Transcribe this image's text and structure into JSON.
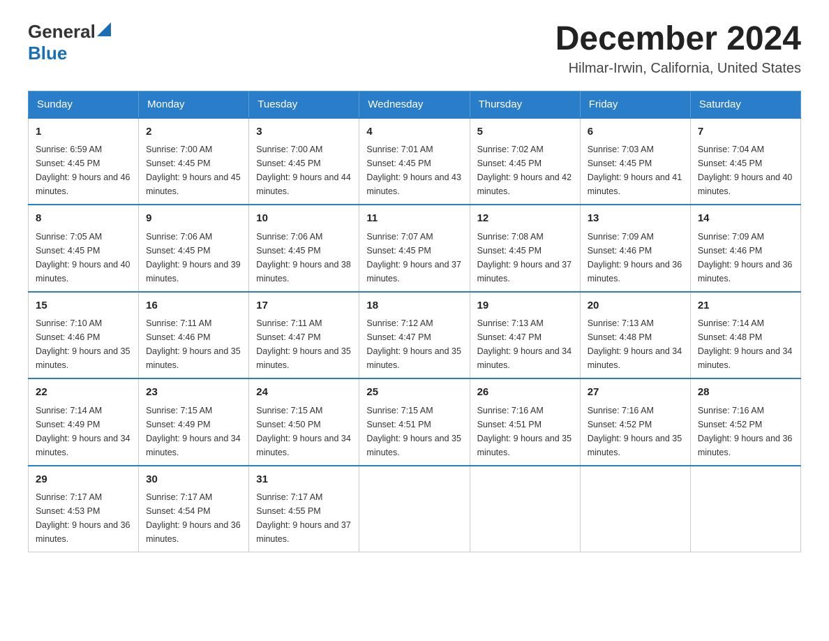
{
  "header": {
    "logo": {
      "text_general": "General",
      "text_blue": "Blue",
      "aria": "GeneralBlue logo"
    },
    "title": "December 2024",
    "location": "Hilmar-Irwin, California, United States"
  },
  "weekdays": [
    "Sunday",
    "Monday",
    "Tuesday",
    "Wednesday",
    "Thursday",
    "Friday",
    "Saturday"
  ],
  "weeks": [
    [
      {
        "day": "1",
        "sunrise": "6:59 AM",
        "sunset": "4:45 PM",
        "daylight": "9 hours and 46 minutes."
      },
      {
        "day": "2",
        "sunrise": "7:00 AM",
        "sunset": "4:45 PM",
        "daylight": "9 hours and 45 minutes."
      },
      {
        "day": "3",
        "sunrise": "7:00 AM",
        "sunset": "4:45 PM",
        "daylight": "9 hours and 44 minutes."
      },
      {
        "day": "4",
        "sunrise": "7:01 AM",
        "sunset": "4:45 PM",
        "daylight": "9 hours and 43 minutes."
      },
      {
        "day": "5",
        "sunrise": "7:02 AM",
        "sunset": "4:45 PM",
        "daylight": "9 hours and 42 minutes."
      },
      {
        "day": "6",
        "sunrise": "7:03 AM",
        "sunset": "4:45 PM",
        "daylight": "9 hours and 41 minutes."
      },
      {
        "day": "7",
        "sunrise": "7:04 AM",
        "sunset": "4:45 PM",
        "daylight": "9 hours and 40 minutes."
      }
    ],
    [
      {
        "day": "8",
        "sunrise": "7:05 AM",
        "sunset": "4:45 PM",
        "daylight": "9 hours and 40 minutes."
      },
      {
        "day": "9",
        "sunrise": "7:06 AM",
        "sunset": "4:45 PM",
        "daylight": "9 hours and 39 minutes."
      },
      {
        "day": "10",
        "sunrise": "7:06 AM",
        "sunset": "4:45 PM",
        "daylight": "9 hours and 38 minutes."
      },
      {
        "day": "11",
        "sunrise": "7:07 AM",
        "sunset": "4:45 PM",
        "daylight": "9 hours and 37 minutes."
      },
      {
        "day": "12",
        "sunrise": "7:08 AM",
        "sunset": "4:45 PM",
        "daylight": "9 hours and 37 minutes."
      },
      {
        "day": "13",
        "sunrise": "7:09 AM",
        "sunset": "4:46 PM",
        "daylight": "9 hours and 36 minutes."
      },
      {
        "day": "14",
        "sunrise": "7:09 AM",
        "sunset": "4:46 PM",
        "daylight": "9 hours and 36 minutes."
      }
    ],
    [
      {
        "day": "15",
        "sunrise": "7:10 AM",
        "sunset": "4:46 PM",
        "daylight": "9 hours and 35 minutes."
      },
      {
        "day": "16",
        "sunrise": "7:11 AM",
        "sunset": "4:46 PM",
        "daylight": "9 hours and 35 minutes."
      },
      {
        "day": "17",
        "sunrise": "7:11 AM",
        "sunset": "4:47 PM",
        "daylight": "9 hours and 35 minutes."
      },
      {
        "day": "18",
        "sunrise": "7:12 AM",
        "sunset": "4:47 PM",
        "daylight": "9 hours and 35 minutes."
      },
      {
        "day": "19",
        "sunrise": "7:13 AM",
        "sunset": "4:47 PM",
        "daylight": "9 hours and 34 minutes."
      },
      {
        "day": "20",
        "sunrise": "7:13 AM",
        "sunset": "4:48 PM",
        "daylight": "9 hours and 34 minutes."
      },
      {
        "day": "21",
        "sunrise": "7:14 AM",
        "sunset": "4:48 PM",
        "daylight": "9 hours and 34 minutes."
      }
    ],
    [
      {
        "day": "22",
        "sunrise": "7:14 AM",
        "sunset": "4:49 PM",
        "daylight": "9 hours and 34 minutes."
      },
      {
        "day": "23",
        "sunrise": "7:15 AM",
        "sunset": "4:49 PM",
        "daylight": "9 hours and 34 minutes."
      },
      {
        "day": "24",
        "sunrise": "7:15 AM",
        "sunset": "4:50 PM",
        "daylight": "9 hours and 34 minutes."
      },
      {
        "day": "25",
        "sunrise": "7:15 AM",
        "sunset": "4:51 PM",
        "daylight": "9 hours and 35 minutes."
      },
      {
        "day": "26",
        "sunrise": "7:16 AM",
        "sunset": "4:51 PM",
        "daylight": "9 hours and 35 minutes."
      },
      {
        "day": "27",
        "sunrise": "7:16 AM",
        "sunset": "4:52 PM",
        "daylight": "9 hours and 35 minutes."
      },
      {
        "day": "28",
        "sunrise": "7:16 AM",
        "sunset": "4:52 PM",
        "daylight": "9 hours and 36 minutes."
      }
    ],
    [
      {
        "day": "29",
        "sunrise": "7:17 AM",
        "sunset": "4:53 PM",
        "daylight": "9 hours and 36 minutes."
      },
      {
        "day": "30",
        "sunrise": "7:17 AM",
        "sunset": "4:54 PM",
        "daylight": "9 hours and 36 minutes."
      },
      {
        "day": "31",
        "sunrise": "7:17 AM",
        "sunset": "4:55 PM",
        "daylight": "9 hours and 37 minutes."
      },
      null,
      null,
      null,
      null
    ]
  ]
}
